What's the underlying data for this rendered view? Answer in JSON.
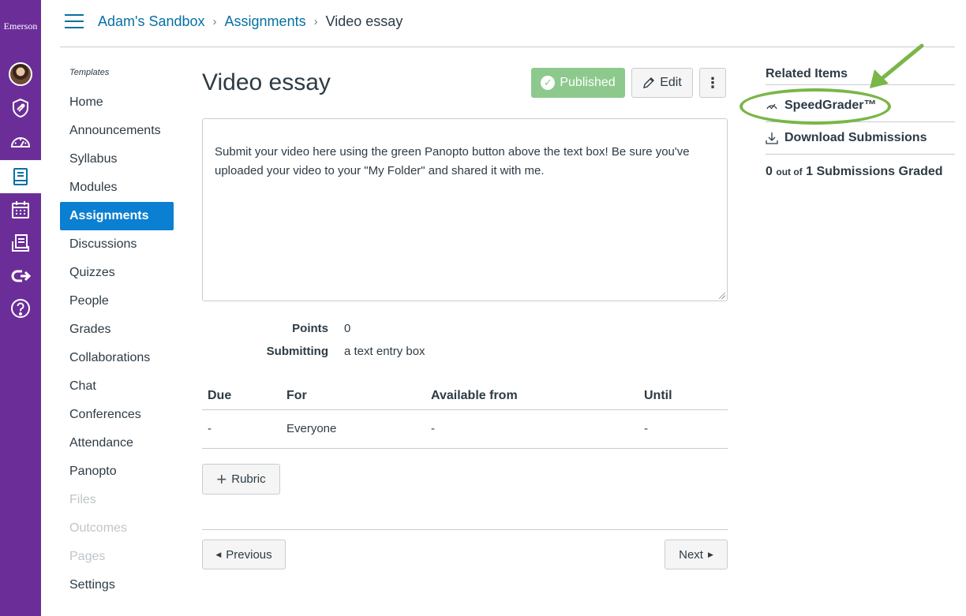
{
  "global_nav": {
    "brand": "Emerson",
    "items": [
      {
        "icon": "user-avatar"
      },
      {
        "icon": "shield-badge-icon"
      },
      {
        "icon": "dashboard-gauge-icon"
      },
      {
        "icon": "courses-book-icon"
      },
      {
        "icon": "calendar-icon"
      },
      {
        "icon": "inbox-icon"
      },
      {
        "icon": "commons-arrow-icon"
      },
      {
        "icon": "help-icon"
      }
    ]
  },
  "breadcrumb": {
    "course": "Adam's Sandbox",
    "section": "Assignments",
    "current": "Video essay"
  },
  "course_nav": {
    "templates_label": "Templates",
    "items": [
      {
        "label": "Home"
      },
      {
        "label": "Announcements"
      },
      {
        "label": "Syllabus"
      },
      {
        "label": "Modules"
      },
      {
        "label": "Assignments"
      },
      {
        "label": "Discussions"
      },
      {
        "label": "Quizzes"
      },
      {
        "label": "People"
      },
      {
        "label": "Grades"
      },
      {
        "label": "Collaborations"
      },
      {
        "label": "Chat"
      },
      {
        "label": "Conferences"
      },
      {
        "label": "Attendance"
      },
      {
        "label": "Panopto"
      },
      {
        "label": "Files"
      },
      {
        "label": "Outcomes"
      },
      {
        "label": "Pages"
      },
      {
        "label": "Settings"
      }
    ],
    "active_item": "Assignments"
  },
  "assignment": {
    "title": "Video essay",
    "published_label": "Published",
    "edit_label": "Edit",
    "kebab_label": "⋮",
    "description": "Submit your video here using the green Panopto button above the text box! Be sure you've uploaded your video to your \"My Folder\" and shared it with me.",
    "points_label": "Points",
    "points_value": "0",
    "submitting_label": "Submitting",
    "submitting_value": "a text entry box"
  },
  "due_table": {
    "headers": [
      "Due",
      "For",
      "Available from",
      "Until"
    ],
    "rows": [
      [
        "-",
        "Everyone",
        "-",
        "-"
      ]
    ]
  },
  "rubric_button": "Rubric",
  "pagination": {
    "previous": "Previous",
    "next": "Next"
  },
  "related": {
    "title": "Related Items",
    "speedgrader": "SpeedGrader™",
    "download": "Download Submissions",
    "graded_count": "0",
    "graded_out_of": "out of",
    "graded_total": "1 Submissions Graded"
  },
  "colors": {
    "global_nav": "#6b2e99",
    "link": "#0770a3",
    "active_nav": "#0b7fd1",
    "published": "#8dc98d",
    "annotation": "#7ab648"
  }
}
